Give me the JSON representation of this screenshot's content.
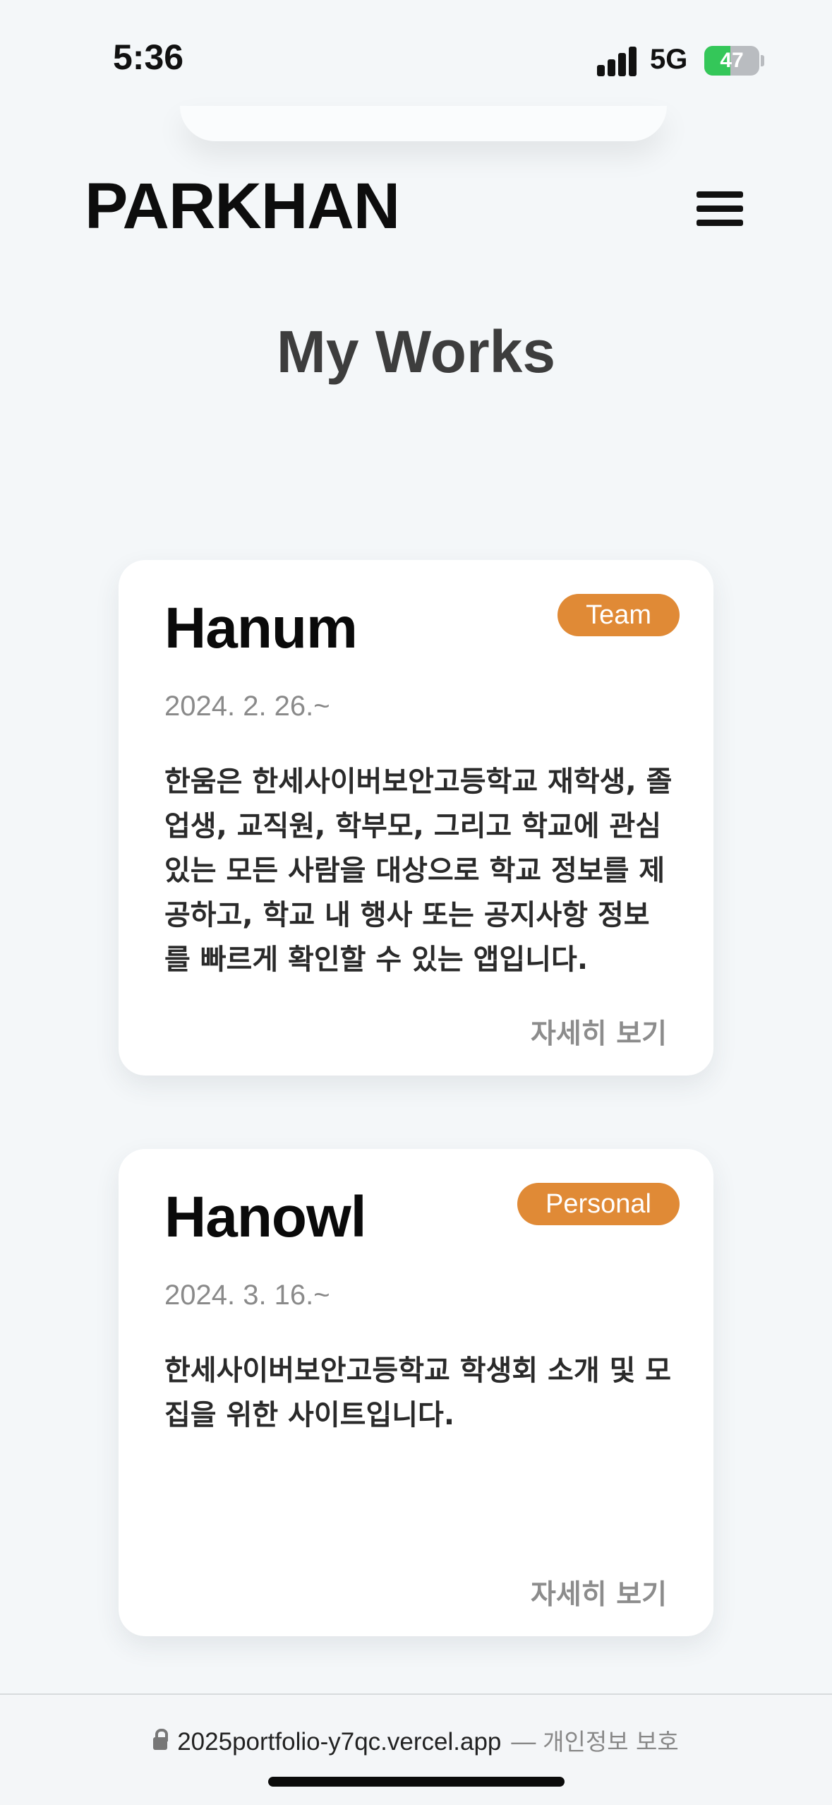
{
  "status_bar": {
    "time": "5:36",
    "network": "5G",
    "battery": "47",
    "battery_level": 0.47
  },
  "header": {
    "logo": "PARKHAN",
    "menu_icon": "hamburger-icon"
  },
  "page_title": "My Works",
  "works": [
    {
      "title": "Hanum",
      "badge": "Team",
      "date": "2024. 2. 26.~",
      "description": "한움은 한세사이버보안고등학교 재학생, 졸업생, 교직원, 학부모, 그리고 학교에 관심 있는 모든 사람을 대상으로 학교 정보를 제공하고, 학교 내 행사 또는 공지사항 정보를 빠르게 확인할 수 있는 앱입니다.",
      "link": "자세히 보기"
    },
    {
      "title": "Hanowl",
      "badge": "Personal",
      "date": "2024. 3. 16.~",
      "description": "한세사이버보안고등학교 학생회 소개 및 모집을 위한 사이트입니다.",
      "link": "자세히 보기"
    }
  ],
  "browser": {
    "url": "2025portfolio-y7qc.vercel.app",
    "separator": "—",
    "privacy": "개인정보 보호"
  },
  "colors": {
    "badge": "#e08a36",
    "background": "#f4f7f9",
    "battery_fill": "#34c759"
  }
}
